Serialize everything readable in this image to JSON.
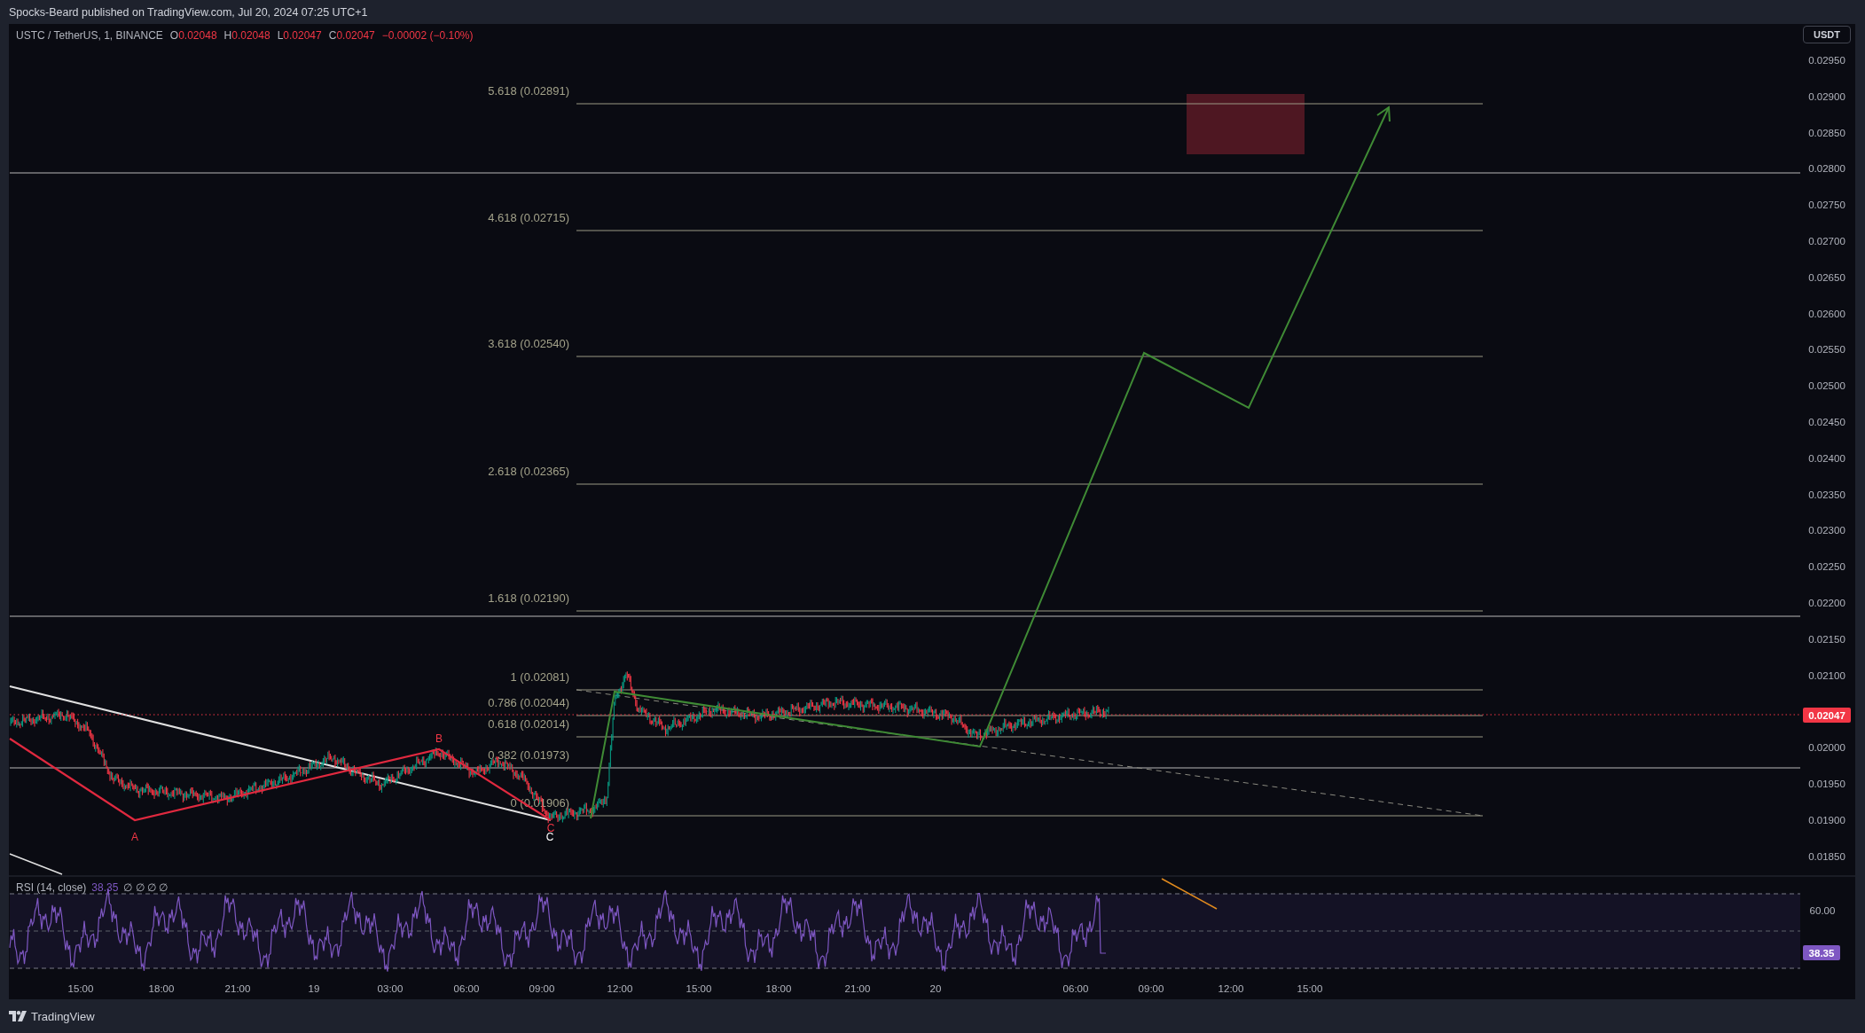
{
  "header": {
    "text": "Spocks-Beard published on TradingView.com, Jul 20, 2024 07:25 UTC+1"
  },
  "legend": {
    "symbol": "USTC / TetherUS, 1, BINANCE",
    "ohlc": [
      {
        "label": "O",
        "value": "0.02048"
      },
      {
        "label": "H",
        "value": "0.02048"
      },
      {
        "label": "L",
        "value": "0.02047"
      },
      {
        "label": "C",
        "value": "0.02047"
      }
    ],
    "change": "−0.00002 (−0.10%)"
  },
  "currency_button": {
    "label": "USDT"
  },
  "price_axis": {
    "labels": [
      "0.02950",
      "0.02900",
      "0.02850",
      "0.02800",
      "0.02750",
      "0.02700",
      "0.02650",
      "0.02600",
      "0.02550",
      "0.02500",
      "0.02450",
      "0.02400",
      "0.02350",
      "0.02300",
      "0.02250",
      "0.02200",
      "0.02150",
      "0.02100",
      "0.02000",
      "0.01950",
      "0.01900",
      "0.01850"
    ],
    "current_price": "0.02047"
  },
  "fib_levels": [
    "5.618 (0.02891)",
    "4.618 (0.02715)",
    "3.618 (0.02540)",
    "2.618 (0.02365)",
    "1.618 (0.02190)",
    "1 (0.02081)",
    "0.786 (0.02044)",
    "0.618 (0.02014)",
    "0.382 (0.01973)",
    "0 (0.01906)"
  ],
  "wave_labels": [
    {
      "text": "A",
      "color": "#f23645"
    },
    {
      "text": "B",
      "color": "#f23645"
    },
    {
      "text": "C",
      "color": "#f23645"
    },
    {
      "text": "C",
      "color": "#ffffff"
    }
  ],
  "rsi": {
    "title": "RSI (14, close)",
    "value": "38.35",
    "extras": "∅ ∅ ∅ ∅",
    "axis_label": "60.00",
    "current": "38.35"
  },
  "time_axis": [
    "15:00",
    "18:00",
    "21:00",
    "19",
    "03:00",
    "06:00",
    "09:00",
    "12:00",
    "15:00",
    "18:00",
    "21:00",
    "20",
    "06:00",
    "09:00",
    "12:00",
    "15:00"
  ],
  "footer": {
    "brand": "TradingView"
  }
}
